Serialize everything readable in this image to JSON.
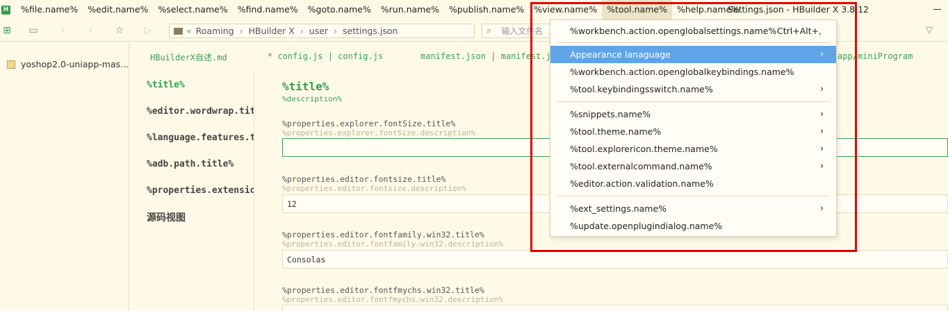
{
  "menubar": {
    "items": [
      "%file.name%",
      "%edit.name%",
      "%select.name%",
      "%find.name%",
      "%goto.name%",
      "%run.name%",
      "%publish.name%",
      "%view.name%",
      "%tool.name%",
      "%help.name%"
    ],
    "window_title": "Settings.json - HBuilder X 3.8.12"
  },
  "toolbar": {
    "breadcrumb": [
      "Roaming",
      "HBuilder X",
      "user",
      "settings.json"
    ],
    "back_glyph": "«",
    "search_placeholder": "输入文件名"
  },
  "sidebar": {
    "project": "yoshop2.0-uniapp-mas..."
  },
  "tabs": [
    "HBuilderX自述.md",
    "* config.js | config.js",
    "manifest.json | manifest.js",
    "app/miniProgram"
  ],
  "settings_nav": [
    "%title%",
    "%editor.wordwrap.title%",
    "%language.features.title%",
    "%adb.path.title%",
    "%properties.extensions.title%",
    "源码视图"
  ],
  "content": {
    "section_title": "%title%",
    "section_desc": "%description%",
    "props": [
      {
        "title": "%properties.explorer.fontSize.title%",
        "desc": "%properties.explorer.fontSize.description%",
        "value": ""
      },
      {
        "title": "%properties.editor.fontsize.title%",
        "desc": "%properties.editor.fontsize.description%",
        "value": "12"
      },
      {
        "title": "%properties.editor.fontfamily.win32.title%",
        "desc": "%properties.editor.fontfamily.win32.description%",
        "value": "Consolas"
      },
      {
        "title": "%properties.editor.fontfmychs.win32.title%",
        "desc": "%properties.editor.fontfmychs.win32.description%",
        "value": ""
      }
    ]
  },
  "tool_menu": {
    "items": [
      {
        "label": "%workbench.action.openglobalsettings.name%",
        "shortcut": "Ctrl+Alt+,"
      },
      {
        "label": "Appearance lanaguage",
        "arrow": "›"
      },
      {
        "label": "%workbench.action.openglobalkeybindings.name%"
      },
      {
        "label": "%tool.keybindingsswitch.name%",
        "arrow": "›"
      },
      {
        "label": "%snippets.name%",
        "arrow": "›"
      },
      {
        "label": "%tool.theme.name%",
        "arrow": "›"
      },
      {
        "label": "%tool.explorericon.theme.name%",
        "arrow": "›"
      },
      {
        "label": "%tool.externalcommand.name%",
        "arrow": "›"
      },
      {
        "label": "%editor.action.validation.name%"
      },
      {
        "label": "%ext_settings.name%",
        "arrow": "›"
      },
      {
        "label": "%update.openplugindialog.name%"
      }
    ]
  },
  "colors": {
    "accent_green": "#2e9e4c",
    "highlight_blue": "#60a4e8",
    "annotation_red": "#e30000",
    "background": "#fffae8"
  }
}
